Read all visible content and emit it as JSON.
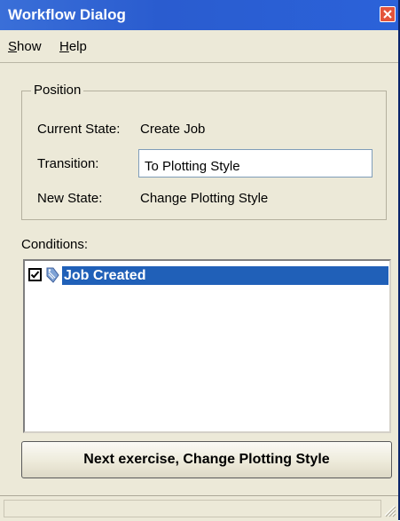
{
  "window": {
    "title": "Workflow Dialog"
  },
  "menu": {
    "show": {
      "accel": "S",
      "rest": "how"
    },
    "help": {
      "accel": "H",
      "rest": "elp"
    }
  },
  "position": {
    "legend": "Position",
    "current_state_label": "Current State:",
    "current_state_value": "Create Job",
    "transition_label": "Transition:",
    "transition_value": "To Plotting Style",
    "new_state_label": "New State:",
    "new_state_value": "Change Plotting Style"
  },
  "conditions": {
    "label": "Conditions:",
    "items": [
      {
        "label": "Job Created",
        "checked": true,
        "selected": true,
        "icon": "tag-icon"
      }
    ]
  },
  "action_button": {
    "label": "Next exercise, Change Plotting Style"
  },
  "colors": {
    "titlebar": "#2a5ccf",
    "selection": "#2060b8",
    "dialog_bg": "#ece9d8",
    "close_button": "#e3543b"
  }
}
